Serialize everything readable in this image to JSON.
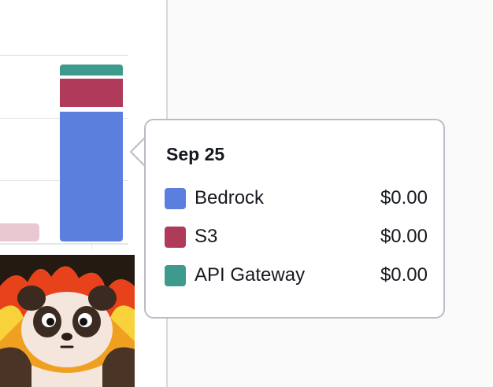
{
  "colors": {
    "bedrock": "#5b7fdd",
    "s3": "#b03a5a",
    "api_gateway": "#3d9a8c",
    "ghost_bar": "#eac8d2",
    "gridline": "#e4e6e9"
  },
  "chart_data": {
    "type": "bar",
    "stacked": true,
    "series": [
      {
        "name": "Bedrock",
        "values": [
          0.0
        ]
      },
      {
        "name": "S3",
        "values": [
          0.0
        ]
      },
      {
        "name": "API Gateway",
        "values": [
          0.0
        ]
      }
    ],
    "categories": [
      "Sep 25"
    ],
    "grid": true
  },
  "tooltip": {
    "title": "Sep 25",
    "rows": [
      {
        "label": "Bedrock",
        "value": "$0.00",
        "color_key": "bedrock",
        "icon": "bedrock-color-swatch"
      },
      {
        "label": "S3",
        "value": "$0.00",
        "color_key": "s3",
        "icon": "s3-color-swatch"
      },
      {
        "label": "API Gateway",
        "value": "$0.00",
        "color_key": "api_gateway",
        "icon": "api-gateway-color-swatch"
      }
    ]
  },
  "avatar": {
    "icon": "panda-avatar-icon"
  }
}
